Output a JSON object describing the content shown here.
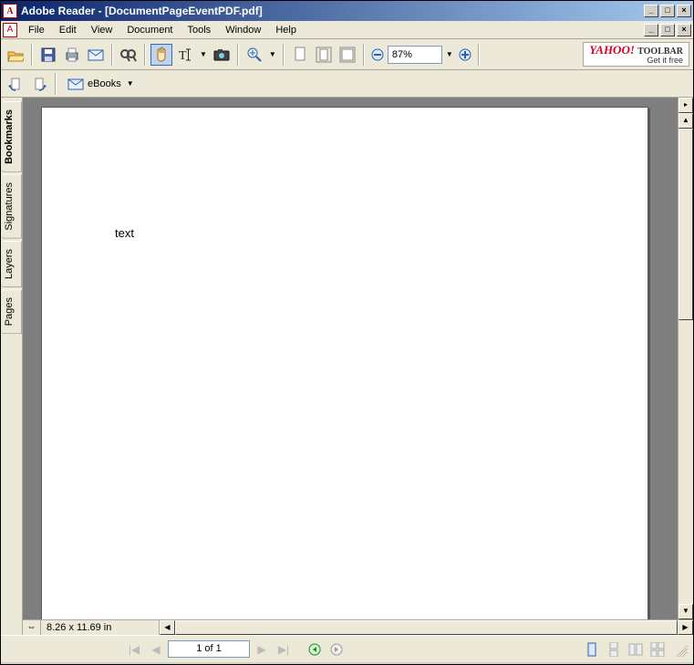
{
  "title": "Adobe Reader - [DocumentPageEventPDF.pdf]",
  "menus": [
    "File",
    "Edit",
    "View",
    "Document",
    "Tools",
    "Window",
    "Help"
  ],
  "toolbar": {
    "zoom_value": "87%",
    "ebooks_label": "eBooks"
  },
  "yahoo": {
    "brand": "YAHOO!",
    "toolbar": "TOOLBAR",
    "sub": "Get it free"
  },
  "sidebar_tabs": [
    "Bookmarks",
    "Signatures",
    "Layers",
    "Pages"
  ],
  "document": {
    "body_text": "text",
    "page_dimensions": "8.26 x 11.69 in",
    "page_indicator": "1 of 1"
  },
  "window_buttons": {
    "min": "_",
    "max": "□",
    "close": "×"
  }
}
